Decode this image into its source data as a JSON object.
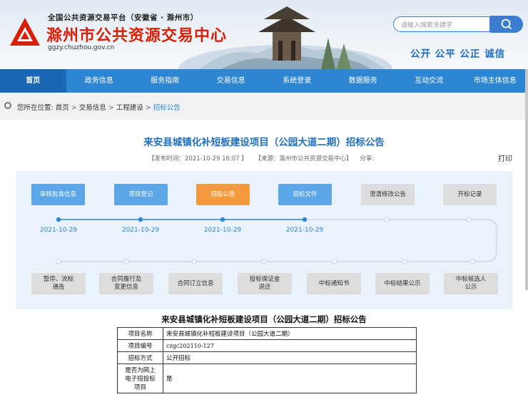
{
  "header": {
    "sup_title": "全国公共资源交易平台（安徽省 · 滁州市）",
    "main_title": "滁州市公共资源交易中心",
    "domain": "ggzy.chuzhou.gov.cn",
    "search_placeholder": "请输入搜索关键字",
    "slogan": "公开 公平 公正 诚信"
  },
  "nav": {
    "items": [
      {
        "label": "首页",
        "active": true
      },
      {
        "label": "政务信息"
      },
      {
        "label": "服务指南"
      },
      {
        "label": "交易信息"
      },
      {
        "label": "系统登录"
      },
      {
        "label": "数据服务"
      },
      {
        "label": "互动交流"
      },
      {
        "label": "市场主体信息"
      }
    ]
  },
  "breadcrumb": {
    "prefix": "您所在位置:",
    "items": [
      "首页",
      "交易信息",
      "工程建设"
    ],
    "separator": ">",
    "current": "招标公告"
  },
  "article": {
    "title": "来安县城镇化补短板建设项目（公园大道二期）招标公告",
    "publish_time": "【发布时间：2021-10-29 16:07 】",
    "source": "【来源：滁州市公共资源交易中心】",
    "share": "分享:",
    "print": "打印"
  },
  "flow": {
    "top_steps": [
      {
        "label": "审核批准信息",
        "state": "done"
      },
      {
        "label": "项目登记",
        "state": "done"
      },
      {
        "label": "招标公告",
        "state": "current"
      },
      {
        "label": "招标文件",
        "state": "done"
      },
      {
        "label": "澄清修改公告",
        "state": "todo"
      },
      {
        "label": "开标记录",
        "state": "todo"
      }
    ],
    "dates": [
      "2021-10-29",
      "2021-10-29",
      "2021-10-29",
      "2021-10-29"
    ],
    "bottom_steps": [
      {
        "line1": "暂停、流标",
        "line2": "通告"
      },
      {
        "line1": "合同履行及",
        "line2": "变更信息"
      },
      {
        "line1": "合同订立信息",
        "line2": ""
      },
      {
        "line1": "投标保证金",
        "line2": "退还"
      },
      {
        "line1": "中标通知书",
        "line2": ""
      },
      {
        "line1": "中标结果公示",
        "line2": ""
      },
      {
        "line1": "中标候选人",
        "line2": "公示"
      }
    ],
    "colors": {
      "done": "#5aa6e6",
      "current": "#f59a3c",
      "todo": "#dddddd"
    }
  },
  "section": {
    "title": "来安县城镇化补短板建设项目（公园大道二期）招标公告",
    "rows": [
      {
        "key": "项目名称",
        "value": "来安县城镇化补短板建设项目（公园大道二期）"
      },
      {
        "key": "项目编号",
        "value": "czgc202110-127"
      },
      {
        "key": "招标方式",
        "value": "公开招标"
      },
      {
        "key_lines": [
          "是否为网上",
          "电子招投标",
          "项目"
        ],
        "value": "是"
      }
    ]
  }
}
